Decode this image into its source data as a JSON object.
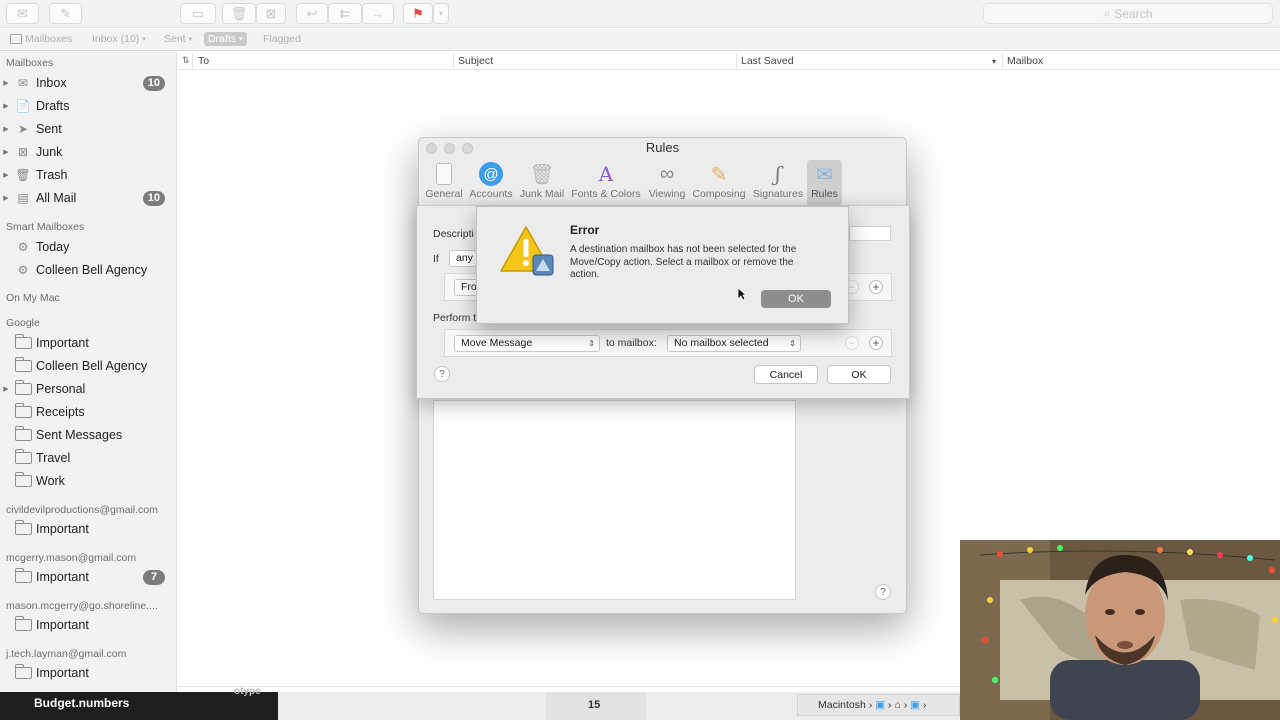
{
  "toolbar": {
    "buttons": [
      "get-mail",
      "compose",
      "archive",
      "delete",
      "junk",
      "reply",
      "reply-all",
      "forward",
      "flag",
      "flag-menu"
    ],
    "search_placeholder": "Search"
  },
  "favorites": {
    "mailboxes": "Mailboxes",
    "inbox": "Inbox (10)",
    "sent": "Sent",
    "drafts": "Drafts",
    "flagged": "Flagged"
  },
  "sidebar": {
    "mailboxes_header": "Mailboxes",
    "mailboxes": [
      {
        "label": "Inbox",
        "badge": "10",
        "icon": "inbox-icon"
      },
      {
        "label": "Drafts",
        "badge": "",
        "icon": "drafts-icon"
      },
      {
        "label": "Sent",
        "badge": "",
        "icon": "sent-icon"
      },
      {
        "label": "Junk",
        "badge": "",
        "icon": "junk-icon"
      },
      {
        "label": "Trash",
        "badge": "",
        "icon": "trash-icon"
      },
      {
        "label": "All Mail",
        "badge": "10",
        "icon": "all-mail-icon"
      }
    ],
    "smart_header": "Smart Mailboxes",
    "smart": [
      {
        "label": "Today"
      },
      {
        "label": "Colleen Bell Agency"
      }
    ],
    "onmymac_header": "On My Mac",
    "google_header": "Google",
    "google": [
      {
        "label": "Important"
      },
      {
        "label": "Colleen Bell Agency"
      },
      {
        "label": "Personal"
      },
      {
        "label": "Receipts"
      },
      {
        "label": "Sent Messages"
      },
      {
        "label": "Travel"
      },
      {
        "label": "Work"
      }
    ],
    "accounts": [
      {
        "header": "civildevilproductions@gmail.com",
        "item": "Important",
        "badge": ""
      },
      {
        "header": "mcgerry.mason@gmail.com",
        "item": "Important",
        "badge": "7"
      },
      {
        "header": "mason.mcgerry@go.shoreline....",
        "item": "Important",
        "badge": ""
      },
      {
        "header": "j.tech.layman@gmail.com",
        "item": "Important",
        "badge": ""
      }
    ]
  },
  "list_header": {
    "to": "To",
    "subject": "Subject",
    "last_saved": "Last Saved",
    "mailbox": "Mailbox"
  },
  "rules_window": {
    "title": "Rules",
    "tabs": [
      {
        "label": "General",
        "icon": "general-switch-icon"
      },
      {
        "label": "Accounts",
        "icon": "at-icon"
      },
      {
        "label": "Junk Mail",
        "icon": "junk-bin-icon"
      },
      {
        "label": "Fonts & Colors",
        "icon": "fonts-icon"
      },
      {
        "label": "Viewing",
        "icon": "glasses-icon"
      },
      {
        "label": "Composing",
        "icon": "pencil-icon"
      },
      {
        "label": "Signatures",
        "icon": "signature-icon"
      },
      {
        "label": "Rules",
        "icon": "rules-envelope-icon"
      }
    ]
  },
  "sheet": {
    "description_label": "Descripti",
    "if_label": "If",
    "any_value": "any",
    "condition_value": "Fro",
    "perform_label": "Perform t",
    "action_value": "Move Message",
    "to_mailbox_label": "to mailbox:",
    "mailbox_value": "No mailbox selected",
    "cancel": "Cancel",
    "ok": "OK",
    "help": "?"
  },
  "alert": {
    "title": "Error",
    "message": "A destination mailbox has not been selected for the Move/Copy action. Select a mailbox or remove the action.",
    "ok": "OK"
  },
  "dock": {
    "left_label": "Budget.numbers",
    "left_sub": "otype",
    "middle_number": "15",
    "path_label": "Macintosh"
  },
  "colors": {
    "badge": "#7c7c7c",
    "alert_ok": "#8e8e8e",
    "flag": "#e24a4a",
    "accounts_blue": "#3b9dec"
  }
}
